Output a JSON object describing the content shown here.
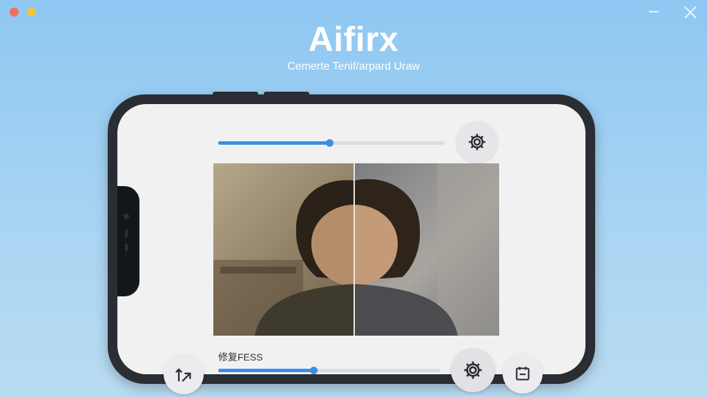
{
  "window": {
    "controls": [
      "close-dot",
      "minimize-dot"
    ],
    "right_controls": [
      "minimize-icon",
      "close-icon"
    ]
  },
  "header": {
    "title": "Aifirx",
    "subtitle": "Cemerte Tenif/arpard Uraw"
  },
  "editor": {
    "top_slider": {
      "value": 0.49
    },
    "bottom_slider": {
      "value": 0.43
    },
    "caption": "修复FESS",
    "compare": {
      "split": 0.49
    }
  },
  "icons": {
    "top_gear": "gear-icon",
    "bottom_left": "transform-arrows-icon",
    "bottom_gear": "gear-icon",
    "bottom_right": "calendar-icon"
  },
  "colors": {
    "accent": "#3a8ee6",
    "background": "#8ec7f2",
    "phone_frame": "#2a2e33"
  }
}
